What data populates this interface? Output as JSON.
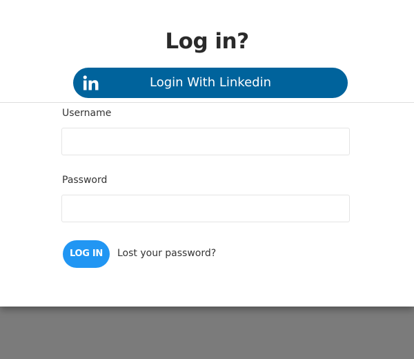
{
  "modal": {
    "title": "Log in?",
    "linkedin_button_label": "Login With Linkedin",
    "linkedin_icon": "linkedin-icon",
    "brand_color": "#00639c"
  },
  "form": {
    "username_label": "Username",
    "username_value": "",
    "password_label": "Password",
    "password_value": "",
    "login_button_label": "LOG IN",
    "login_button_color": "#2196f3",
    "lost_password_label": "Lost your password?"
  }
}
